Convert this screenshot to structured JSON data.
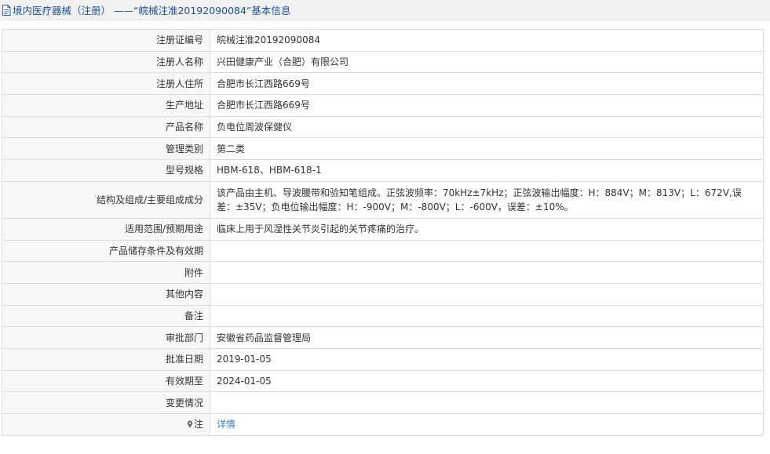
{
  "header": {
    "title": "境内医疗器械（注册） ——“皖械注准20192090084”基本信息"
  },
  "rows": [
    {
      "label": "注册证编号",
      "value": "皖械注准20192090084"
    },
    {
      "label": "注册人名称",
      "value": "兴田健康产业（合肥）有限公司"
    },
    {
      "label": "注册人住所",
      "value": "合肥市长江西路669号"
    },
    {
      "label": "生产地址",
      "value": "合肥市长江西路669号"
    },
    {
      "label": "产品名称",
      "value": "负电位周波保健仪"
    },
    {
      "label": "管理类别",
      "value": "第二类"
    },
    {
      "label": "型号规格",
      "value": "HBM-618、HBM-618-1"
    },
    {
      "label": "结构及组成/主要组成成分",
      "value": "该产品由主机、导波腰带和验知笔组成。正弦波频率：70kHz±7kHz；正弦波输出幅度：H：884V；M：813V；L：672V,误差：±35V；负电位输出幅度：H：-900V；M：-800V；L：-600V，误差：±10%。"
    },
    {
      "label": "适用范围/预期用途",
      "value": "临床上用于风湿性关节炎引起的关节疼痛的治疗。"
    },
    {
      "label": "产品储存条件及有效期",
      "value": ""
    },
    {
      "label": "附件",
      "value": ""
    },
    {
      "label": "其他内容",
      "value": ""
    },
    {
      "label": "备注",
      "value": ""
    },
    {
      "label": "审批部门",
      "value": "安徽省药品监督管理局"
    },
    {
      "label": "批准日期",
      "value": "2019-01-05"
    },
    {
      "label": "有效期至",
      "value": "2024-01-05"
    },
    {
      "label": "变更情况",
      "value": ""
    },
    {
      "label": "注",
      "value": "详情"
    }
  ],
  "icons": {
    "title": "document-icon",
    "note": "pin-icon"
  },
  "colors": {
    "title_text": "#1f4f8f",
    "link": "#3b7fc4",
    "label_bg": "#f7f7f7",
    "border": "#dcdcdc"
  }
}
